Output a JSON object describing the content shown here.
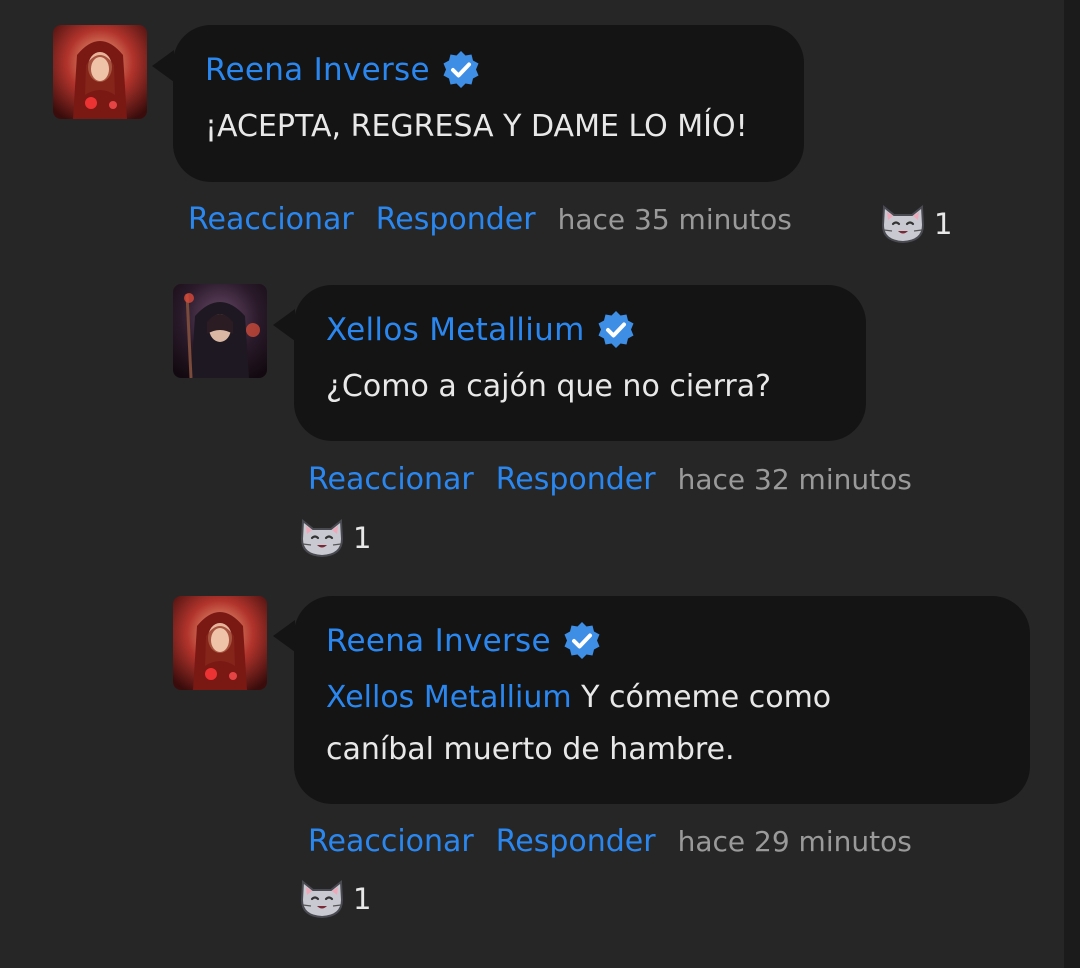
{
  "comments": [
    {
      "author": "Reena Inverse",
      "text": "¡ACEPTA, REGRESA Y DAME LO MÍO!",
      "mention": "",
      "react_label": "Reaccionar",
      "reply_label": "Responder",
      "time": "hace 35 minutos",
      "reaction_icon": "cat-face-icon",
      "reaction_count": "1"
    },
    {
      "author": "Xellos Metallium",
      "text": "¿Como a cajón que no cierra?",
      "mention": "",
      "react_label": "Reaccionar",
      "reply_label": "Responder",
      "time": "hace 32 minutos",
      "reaction_icon": "cat-face-icon",
      "reaction_count": "1"
    },
    {
      "author": "Reena Inverse",
      "mention": "Xellos Metallium",
      "text_line1": " Y cómeme como",
      "text_line2": "caníbal muerto de hambre.",
      "react_label": "Reaccionar",
      "reply_label": "Responder",
      "time": "hace 29 minutos",
      "reaction_icon": "cat-face-icon",
      "reaction_count": "1"
    }
  ],
  "colors": {
    "background": "#262626",
    "bubble": "#141414",
    "link": "#2b87f0",
    "text": "#e8e8e8",
    "muted": "#9a9a9a",
    "verified": "#3e8ee6"
  }
}
